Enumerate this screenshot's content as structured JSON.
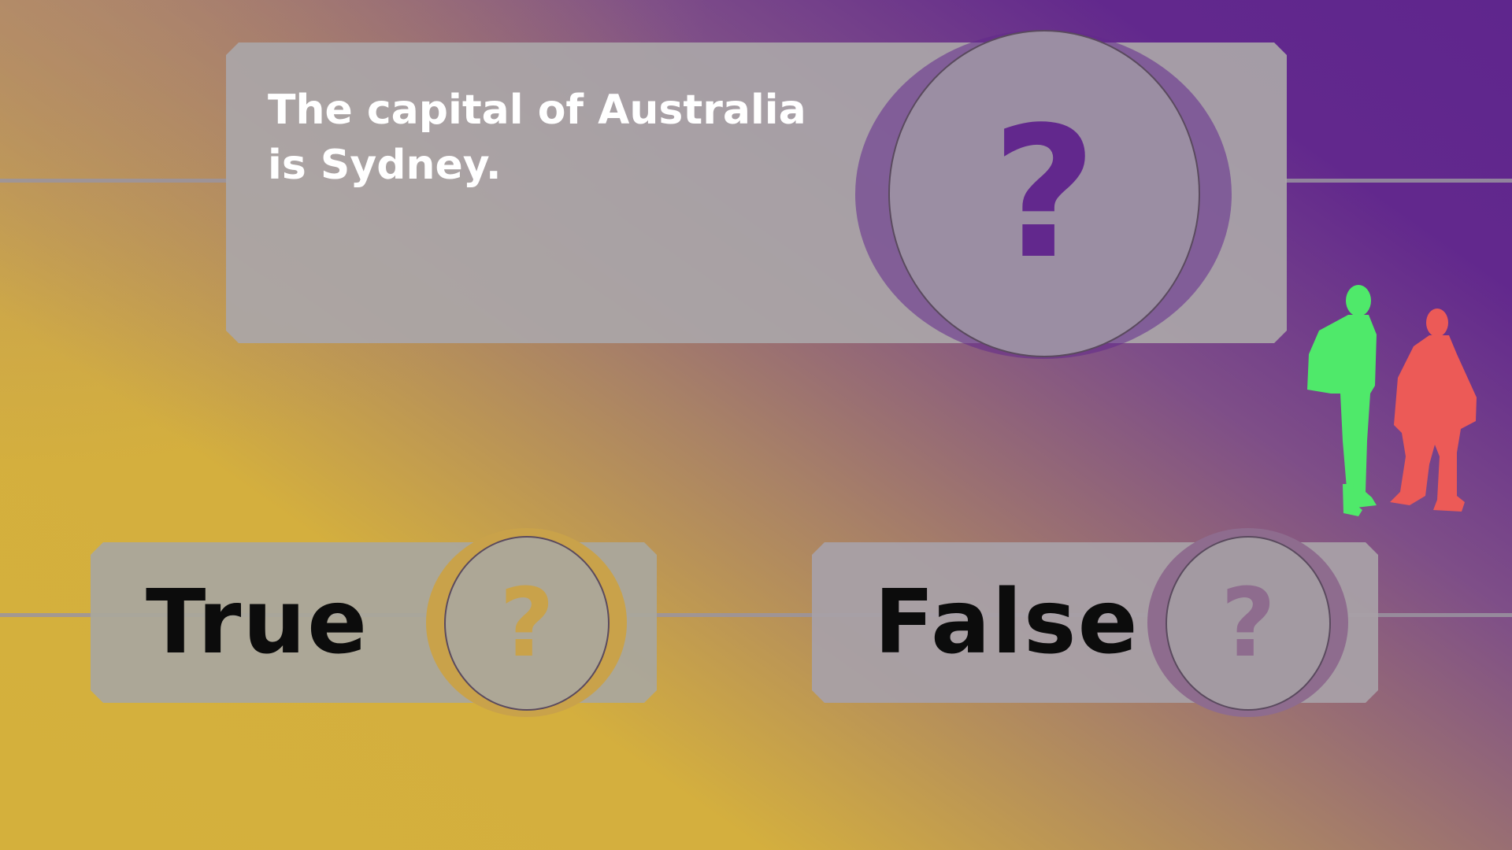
{
  "question": {
    "text": "The capital of Australia is Sydney.",
    "badge_icon": "question-mark-icon",
    "badge_glyph": "?"
  },
  "answers": [
    {
      "label": "True",
      "badge_glyph": "?",
      "accent": "#c9a24a"
    },
    {
      "label": "False",
      "badge_glyph": "?",
      "accent": "#8e6c8e"
    }
  ],
  "colors": {
    "background_top_right": "#62288d",
    "background_bottom_left": "#d4b03c",
    "question_mark": "#62288d",
    "person_left": "#4fe96a",
    "person_right": "#ec5a57"
  }
}
